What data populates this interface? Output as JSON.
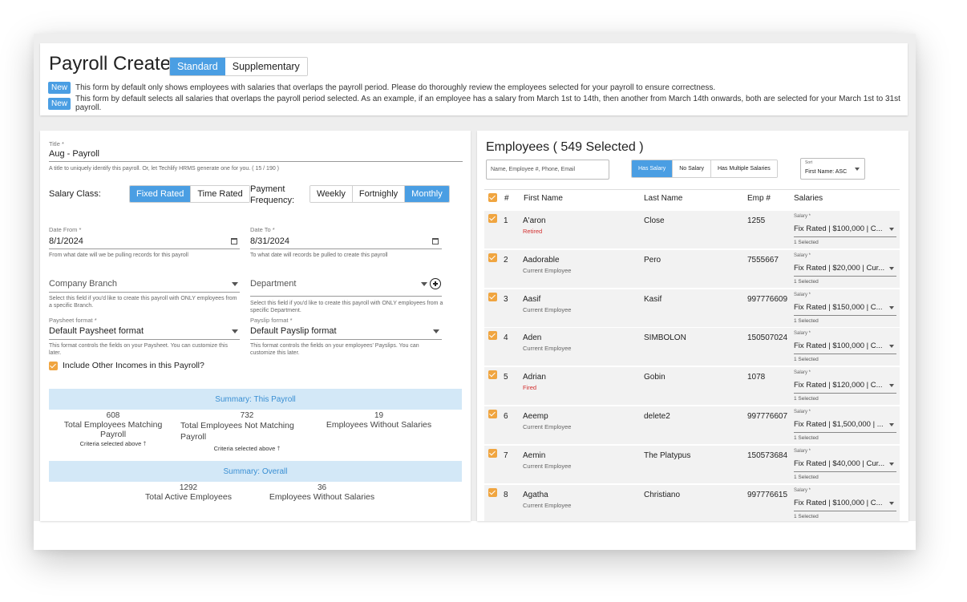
{
  "header": {
    "title": "Payroll Create",
    "mode_tabs": [
      "Standard",
      "Supplementary"
    ],
    "notices": [
      {
        "badge": "New",
        "text": "This form by default only shows employees with salaries that overlaps the payroll period. Please do thoroughly review the employees selected for your payroll to ensure correctness."
      },
      {
        "badge": "New",
        "text": "This form by default selects all salaries that overlaps the payroll period selected. As an example, if an employee has a salary from March 1st to 14th, then another from March 14th onwards, both are selected for your March 1st to 31st payroll."
      }
    ]
  },
  "form": {
    "title_label": "Title *",
    "title_value": "Aug   - Payroll",
    "title_help": "A title to uniquely identify this payroll. Or, let Techlify HRMS generate one for you. ( 15 / 190 )",
    "salary_class_label": "Salary Class:",
    "salary_class_options": [
      "Fixed Rated",
      "Time Rated"
    ],
    "payment_frequency_label": "Payment Frequency:",
    "payment_frequency_options": [
      "Weekly",
      "Fortnighly",
      "Monthly"
    ],
    "date_from_label": "Date From *",
    "date_from_value": "8/1/2024",
    "date_from_help": "From what date will we be pulling records for this payroll",
    "date_to_label": "Date To *",
    "date_to_value": "8/31/2024",
    "date_to_help": "To what date will records be pulled to create this payroll",
    "branch_placeholder": "Company Branch",
    "branch_help": "Select this field if you'd like to create this payroll with ONLY employees from a specific Branch.",
    "department_placeholder": "Department",
    "department_help": "Select this field if you'd like to create this payroll with ONLY employees from a specific Department.",
    "paysheet_label": "Paysheet format *",
    "paysheet_value": "Default Paysheet format",
    "paysheet_help": "This format controls the fields on your Paysheet. You can customize this later.",
    "payslip_label": "Payslip format *",
    "payslip_value": "Default Payslip format",
    "payslip_help": "This format controls the fields on your employees' Payslips. You can customize this later.",
    "include_other_incomes": "Include Other Incomes in this Payroll?"
  },
  "summary_this": {
    "title": "Summary: This Payroll",
    "matching_count": "608",
    "matching_label": "Total Employees Matching Payroll",
    "matching_criteria": "Criteria selected above",
    "not_matching_count": "732",
    "not_matching_label": "Total Employees Not Matching Payroll",
    "not_matching_criteria": "Criteria selected above",
    "without_salaries_count": "19",
    "without_salaries_label": "Employees Without Salaries"
  },
  "summary_overall": {
    "title": "Summary: Overall",
    "active_count": "1292",
    "active_label": "Total Active Employees",
    "without_salaries_count": "36",
    "without_salaries_label": "Employees Without Salaries"
  },
  "employees": {
    "title": "Employees ( 549 Selected )",
    "search_placeholder": "Name, Employee #, Phone, Email",
    "filters": [
      "Has Salary",
      "No Salary",
      "Has Multiple Salaries"
    ],
    "sort_label": "Sort",
    "sort_value": "First Name: ASC",
    "columns": [
      "#",
      "First Name",
      "Last Name",
      "Emp #",
      "Salaries"
    ],
    "salary_field_label": "Salary *",
    "rows": [
      {
        "num": "1",
        "first": "A'aron",
        "status": "Retired",
        "status_color": "#d32f2f",
        "last": "Close",
        "emp": "1255",
        "salary": "Fix Rated | $100,000 | C...",
        "selected": "1 Selected"
      },
      {
        "num": "2",
        "first": "Aadorable",
        "status": "Current Employee",
        "status_color": "#666666",
        "last": "Pero",
        "emp": "7555667",
        "salary": "Fix Rated | $20,000 | Cur...",
        "selected": "1 Selected"
      },
      {
        "num": "3",
        "first": "Aasif",
        "status": "Current Employee",
        "status_color": "#666666",
        "last": "Kasif",
        "emp": "997776609",
        "salary": "Fix Rated | $150,000 | C...",
        "selected": "1 Selected"
      },
      {
        "num": "4",
        "first": "Aden",
        "status": "Current Employee",
        "status_color": "#666666",
        "last": "SIMBOLON",
        "emp": "150507024",
        "salary": "Fix Rated | $100,000 | C...",
        "selected": "1 Selected"
      },
      {
        "num": "5",
        "first": "Adrian",
        "status": "Fired",
        "status_color": "#d32f2f",
        "last": "Gobin",
        "emp": "1078",
        "salary": "Fix Rated | $120,000 | C...",
        "selected": "1 Selected"
      },
      {
        "num": "6",
        "first": "Aeemp",
        "status": "Current Employee",
        "status_color": "#666666",
        "last": "delete2",
        "emp": "997776607",
        "salary": "Fix Rated | $1,500,000 | ...",
        "selected": "1 Selected"
      },
      {
        "num": "7",
        "first": "Aemin",
        "status": "Current Employee",
        "status_color": "#666666",
        "last": "The Platypus",
        "emp": "150573684",
        "salary": "Fix Rated | $40,000 | Cur...",
        "selected": "1 Selected"
      },
      {
        "num": "8",
        "first": "Agatha",
        "status": "Current Employee",
        "status_color": "#666666",
        "last": "Christiano",
        "emp": "997776615",
        "salary": "Fix Rated | $100,000 | C...",
        "selected": "1 Selected"
      }
    ]
  },
  "colors": {
    "accent": "#4a9ee3",
    "checkbox": "#f0a540",
    "summary_bg": "#d3e8f7",
    "status_red": "#d32f2f"
  }
}
